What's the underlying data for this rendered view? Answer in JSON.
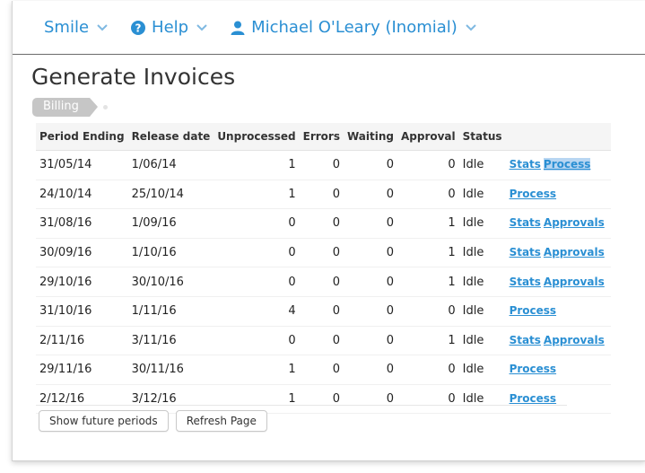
{
  "nav": {
    "items": [
      {
        "label": "Smile",
        "icon": "chevron-down-icon"
      },
      {
        "label": "Help",
        "lead_icon": "help-circle-icon",
        "icon": "chevron-down-icon"
      },
      {
        "label": "Michael O'Leary (Inomial)",
        "lead_icon": "user-icon",
        "icon": "chevron-down-icon"
      }
    ],
    "accent": "#2a8fd3"
  },
  "page": {
    "title": "Generate Invoices",
    "breadcrumb": "Billing"
  },
  "table": {
    "headers": [
      "Period Ending",
      "Release date",
      "Unprocessed",
      "Errors",
      "Waiting",
      "Approval",
      "Status",
      ""
    ],
    "rows": [
      {
        "period_ending": "31/05/14",
        "release_date": "1/06/14",
        "unprocessed": "1",
        "errors": "0",
        "waiting": "0",
        "approval": "0",
        "status": "Idle",
        "actions": [
          "Stats",
          "Process"
        ]
      },
      {
        "period_ending": "24/10/14",
        "release_date": "25/10/14",
        "unprocessed": "1",
        "errors": "0",
        "waiting": "0",
        "approval": "0",
        "status": "Idle",
        "actions": [
          "Process"
        ]
      },
      {
        "period_ending": "31/08/16",
        "release_date": "1/09/16",
        "unprocessed": "0",
        "errors": "0",
        "waiting": "0",
        "approval": "1",
        "status": "Idle",
        "actions": [
          "Stats",
          "Approvals"
        ]
      },
      {
        "period_ending": "30/09/16",
        "release_date": "1/10/16",
        "unprocessed": "0",
        "errors": "0",
        "waiting": "0",
        "approval": "1",
        "status": "Idle",
        "actions": [
          "Stats",
          "Approvals"
        ]
      },
      {
        "period_ending": "29/10/16",
        "release_date": "30/10/16",
        "unprocessed": "0",
        "errors": "0",
        "waiting": "0",
        "approval": "1",
        "status": "Idle",
        "actions": [
          "Stats",
          "Approvals"
        ]
      },
      {
        "period_ending": "31/10/16",
        "release_date": "1/11/16",
        "unprocessed": "4",
        "errors": "0",
        "waiting": "0",
        "approval": "0",
        "status": "Idle",
        "actions": [
          "Process"
        ]
      },
      {
        "period_ending": "2/11/16",
        "release_date": "3/11/16",
        "unprocessed": "0",
        "errors": "0",
        "waiting": "0",
        "approval": "1",
        "status": "Idle",
        "actions": [
          "Stats",
          "Approvals"
        ]
      },
      {
        "period_ending": "29/11/16",
        "release_date": "30/11/16",
        "unprocessed": "1",
        "errors": "0",
        "waiting": "0",
        "approval": "0",
        "status": "Idle",
        "actions": [
          "Process"
        ]
      },
      {
        "period_ending": "2/12/16",
        "release_date": "3/12/16",
        "unprocessed": "1",
        "errors": "0",
        "waiting": "0",
        "approval": "0",
        "status": "Idle",
        "actions": [
          "Process"
        ]
      }
    ]
  },
  "buttons": {
    "show_future": "Show future periods",
    "refresh": "Refresh Page"
  }
}
